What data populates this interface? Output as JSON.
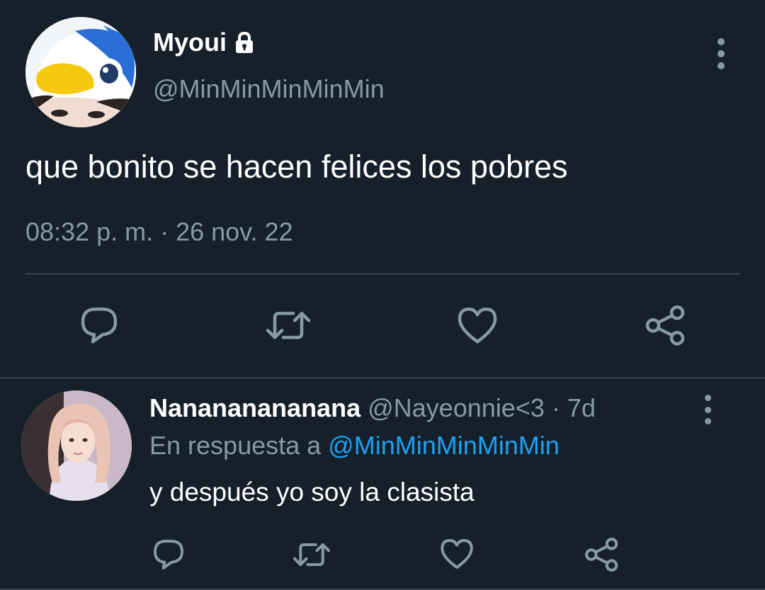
{
  "main_tweet": {
    "display_name": "Myoui",
    "handle": "@MinMinMinMinMin",
    "text": "que bonito se hacen felices los pobres",
    "timestamp": "08:32 p. m. · 26 nov. 22",
    "icons": {
      "lock": "lock-icon",
      "more": "more-vertical-icon",
      "actions": [
        "reply-icon",
        "retweet-icon",
        "like-icon",
        "share-icon"
      ]
    }
  },
  "reply": {
    "display_name": "Nanananananana",
    "meta": "@Nayeonnie<3 · 7d",
    "reply_to_prefix": "En respuesta a",
    "reply_to_handle": "@MinMinMinMinMin",
    "text": "y después yo soy la clasista",
    "icons": {
      "more": "more-vertical-icon",
      "actions": [
        "reply-icon",
        "retweet-icon",
        "like-icon",
        "share-icon"
      ]
    }
  },
  "colors": {
    "background": "#15202b",
    "primary_text": "#ffffff",
    "secondary_text": "#8899a6",
    "link": "#1da1f2",
    "divider": "#38444d"
  }
}
